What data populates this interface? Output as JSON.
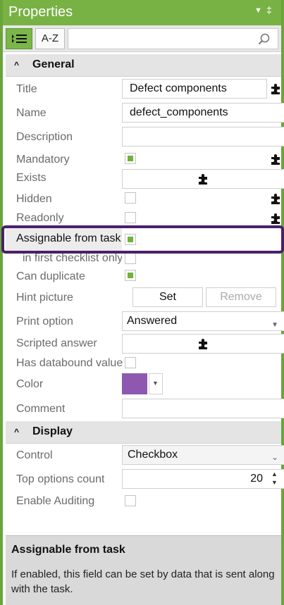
{
  "panel": {
    "title": "Properties",
    "pin_glyph": "▾ ‡"
  },
  "toolbar": {
    "categorized_icon": "categorized-view-icon",
    "az_label": "A-Z",
    "search_placeholder": ""
  },
  "sections": {
    "general": "General",
    "display": "Display"
  },
  "general": {
    "title_label": "Title",
    "title_value": "Defect components",
    "name_label": "Name",
    "name_value": "defect_components",
    "description_label": "Description",
    "description_value": "",
    "mandatory_label": "Mandatory",
    "exists_label": "Exists",
    "hidden_label": "Hidden",
    "readonly_label": "Readonly",
    "assignable_label": "Assignable from task",
    "first_checklist_label": "in first checklist only",
    "can_duplicate_label": "Can duplicate",
    "hint_picture_label": "Hint picture",
    "hint_set": "Set",
    "hint_remove": "Remove",
    "print_option_label": "Print option",
    "print_option_value": "Answered",
    "scripted_answer_label": "Scripted answer",
    "databound_label": "Has databound values",
    "color_label": "Color",
    "color_value": "#8e57b0",
    "comment_label": "Comment",
    "comment_value": ""
  },
  "display": {
    "control_label": "Control",
    "control_value": "Checkbox",
    "top_options_label": "Top options count",
    "top_options_value": "20",
    "enable_auditing_label": "Enable Auditing"
  },
  "description": {
    "title": "Assignable from task",
    "text": "If enabled, this field can be set by data that is sent along with the task."
  },
  "colors": {
    "titlebar": "#78b245",
    "checkbox_on": "#6fb33b",
    "highlight": "#4b1f6b"
  }
}
